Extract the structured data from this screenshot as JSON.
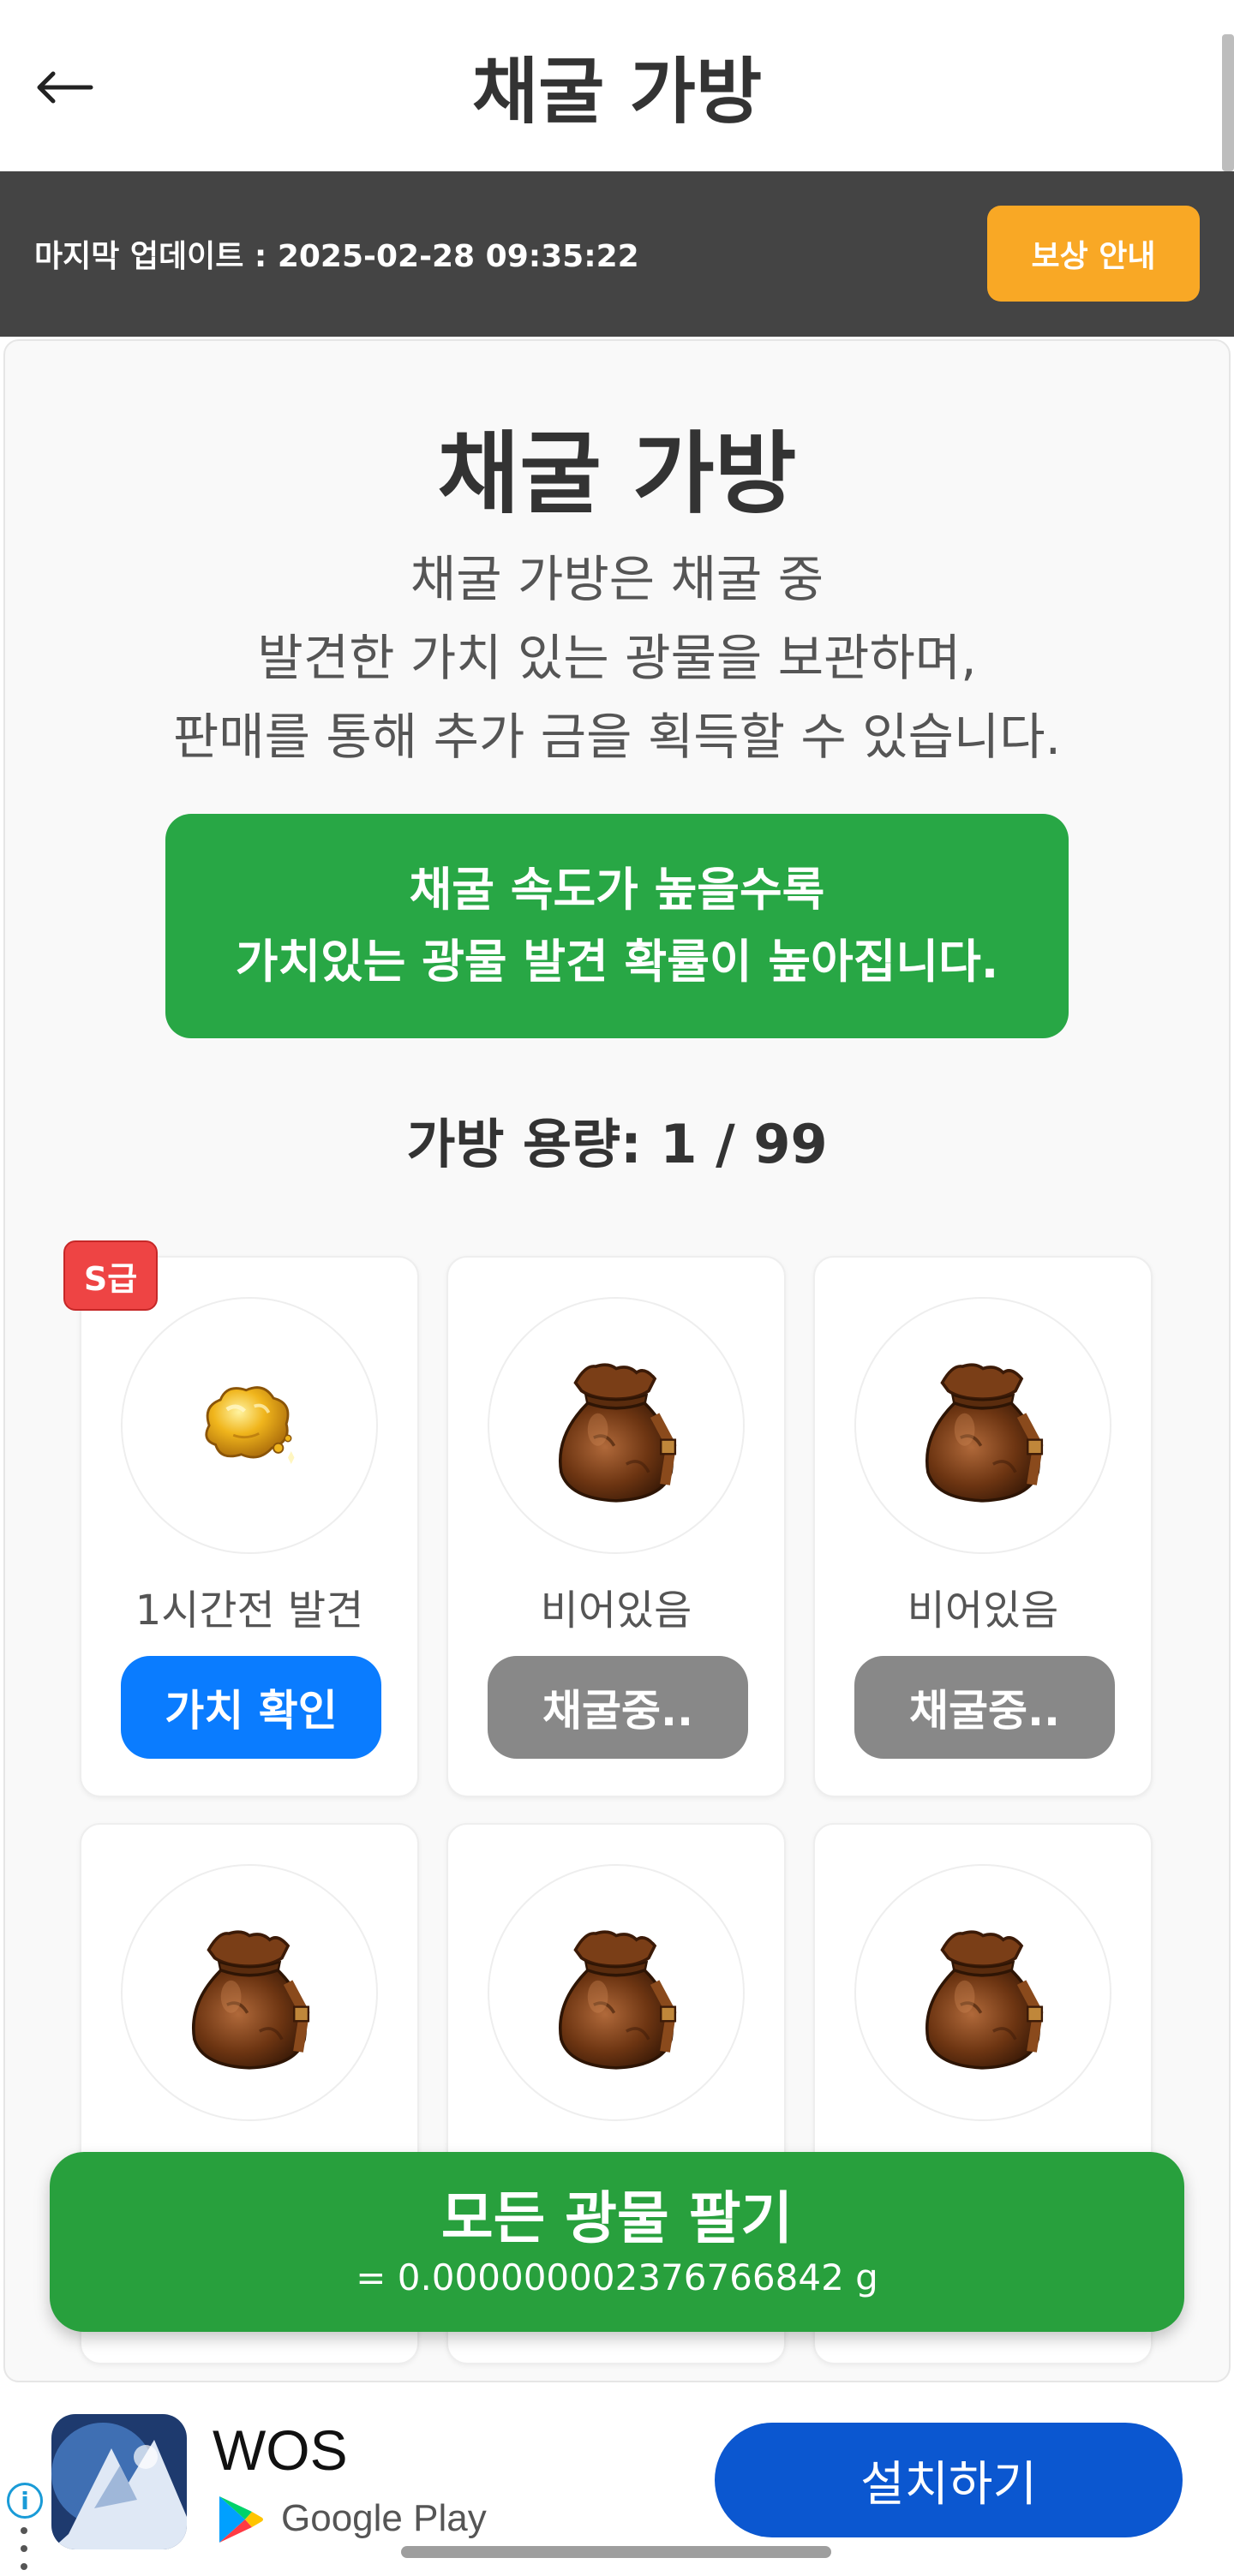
{
  "header": {
    "title": "채굴 가방",
    "back_icon": "arrow-left-icon"
  },
  "update_bar": {
    "last_update": "마지막 업데이트 : 2025-02-28 09:35:22",
    "reward_button": "보상 안내"
  },
  "intro": {
    "title": "채굴 가방",
    "description_lines": [
      "채굴 가방은 채굴 중",
      "발견한 가치 있는 광물을 보관하며,",
      "판매를 통해 추가 금을 획득할 수 있습니다."
    ],
    "notice_lines": [
      "채굴 속도가 높을수록",
      "가치있는 광물 발견 확률이 높아집니다."
    ]
  },
  "bag": {
    "capacity": "가방 용량: 1 / 99",
    "slots": [
      {
        "badge": "S급",
        "icon": "gold-nugget-icon",
        "status": "1시간전 발견",
        "action": "가치 확인"
      },
      {
        "icon": "mining-sack-icon",
        "status": "비어있음",
        "action": "채굴중.."
      },
      {
        "icon": "mining-sack-icon",
        "status": "비어있음",
        "action": "채굴중.."
      },
      {
        "icon": "mining-sack-icon"
      },
      {
        "icon": "mining-sack-icon"
      },
      {
        "icon": "mining-sack-icon"
      }
    ]
  },
  "sell": {
    "label": "모든 광물 팔기",
    "value": "= 0.000000002376766842 g"
  },
  "ad": {
    "app_name": "WOS",
    "store": "Google Play",
    "install_button": "설치하기"
  },
  "colors": {
    "primary_green": "#28a745",
    "action_blue": "#0a7cff",
    "reward_orange": "#f9a825",
    "badge_red": "#ee4444",
    "install_blue": "#0b57d0"
  }
}
